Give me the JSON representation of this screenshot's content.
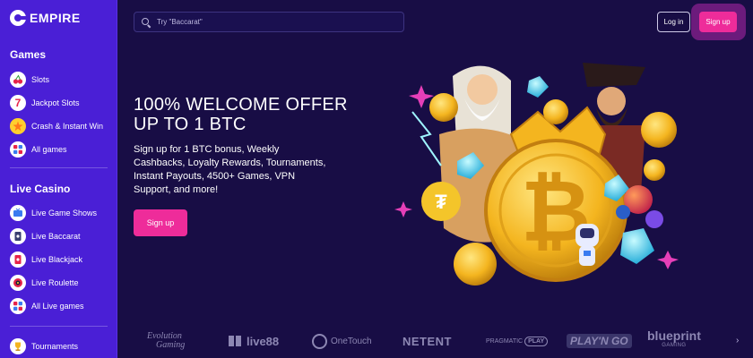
{
  "brand": {
    "name": "EMPIRE"
  },
  "sidebar": {
    "games_title": "Games",
    "games": [
      {
        "label": "Slots",
        "icon": "cherry-icon"
      },
      {
        "label": "Jackpot Slots",
        "icon": "seven-icon"
      },
      {
        "label": "Crash & Instant Win",
        "icon": "star-burst-icon"
      },
      {
        "label": "All games",
        "icon": "grid-icon"
      }
    ],
    "live_title": "Live Casino",
    "live": [
      {
        "label": "Live Game Shows",
        "icon": "tv-icon"
      },
      {
        "label": "Live Baccarat",
        "icon": "card-icon"
      },
      {
        "label": "Live Blackjack",
        "icon": "card-icon"
      },
      {
        "label": "Live Roulette",
        "icon": "roulette-icon"
      },
      {
        "label": "All Live games",
        "icon": "grid-icon"
      }
    ],
    "tournaments": {
      "label": "Tournaments",
      "icon": "trophy-icon"
    }
  },
  "header": {
    "search_placeholder": "Try \"Baccarat\"",
    "login_label": "Log in",
    "signup_label": "Sign up"
  },
  "hero": {
    "title": "100% WELCOME OFFER UP TO 1 BTC",
    "description": "Sign up for 1 BTC bonus, Weekly Cashbacks, Loyalty Rewards, Tournaments, Instant Payouts, 4500+ Games, VPN Support, and more!",
    "cta_label": "Sign up"
  },
  "providers": [
    {
      "name": "Evolution",
      "sub": "Gaming"
    },
    {
      "name": "live88",
      "sub": ""
    },
    {
      "name": "OneTouch",
      "sub": ""
    },
    {
      "name": "NETENT",
      "sub": ""
    },
    {
      "name": "PRAGMATIC",
      "sub": "PLAY"
    },
    {
      "name": "PLAY'N GO",
      "sub": ""
    },
    {
      "name": "blueprint",
      "sub": "GAMING"
    }
  ],
  "colors": {
    "sidebar": "#4a1fd6",
    "background": "#180d45",
    "accent": "#ee2c9a",
    "bitcoin": "#f4b51f"
  }
}
